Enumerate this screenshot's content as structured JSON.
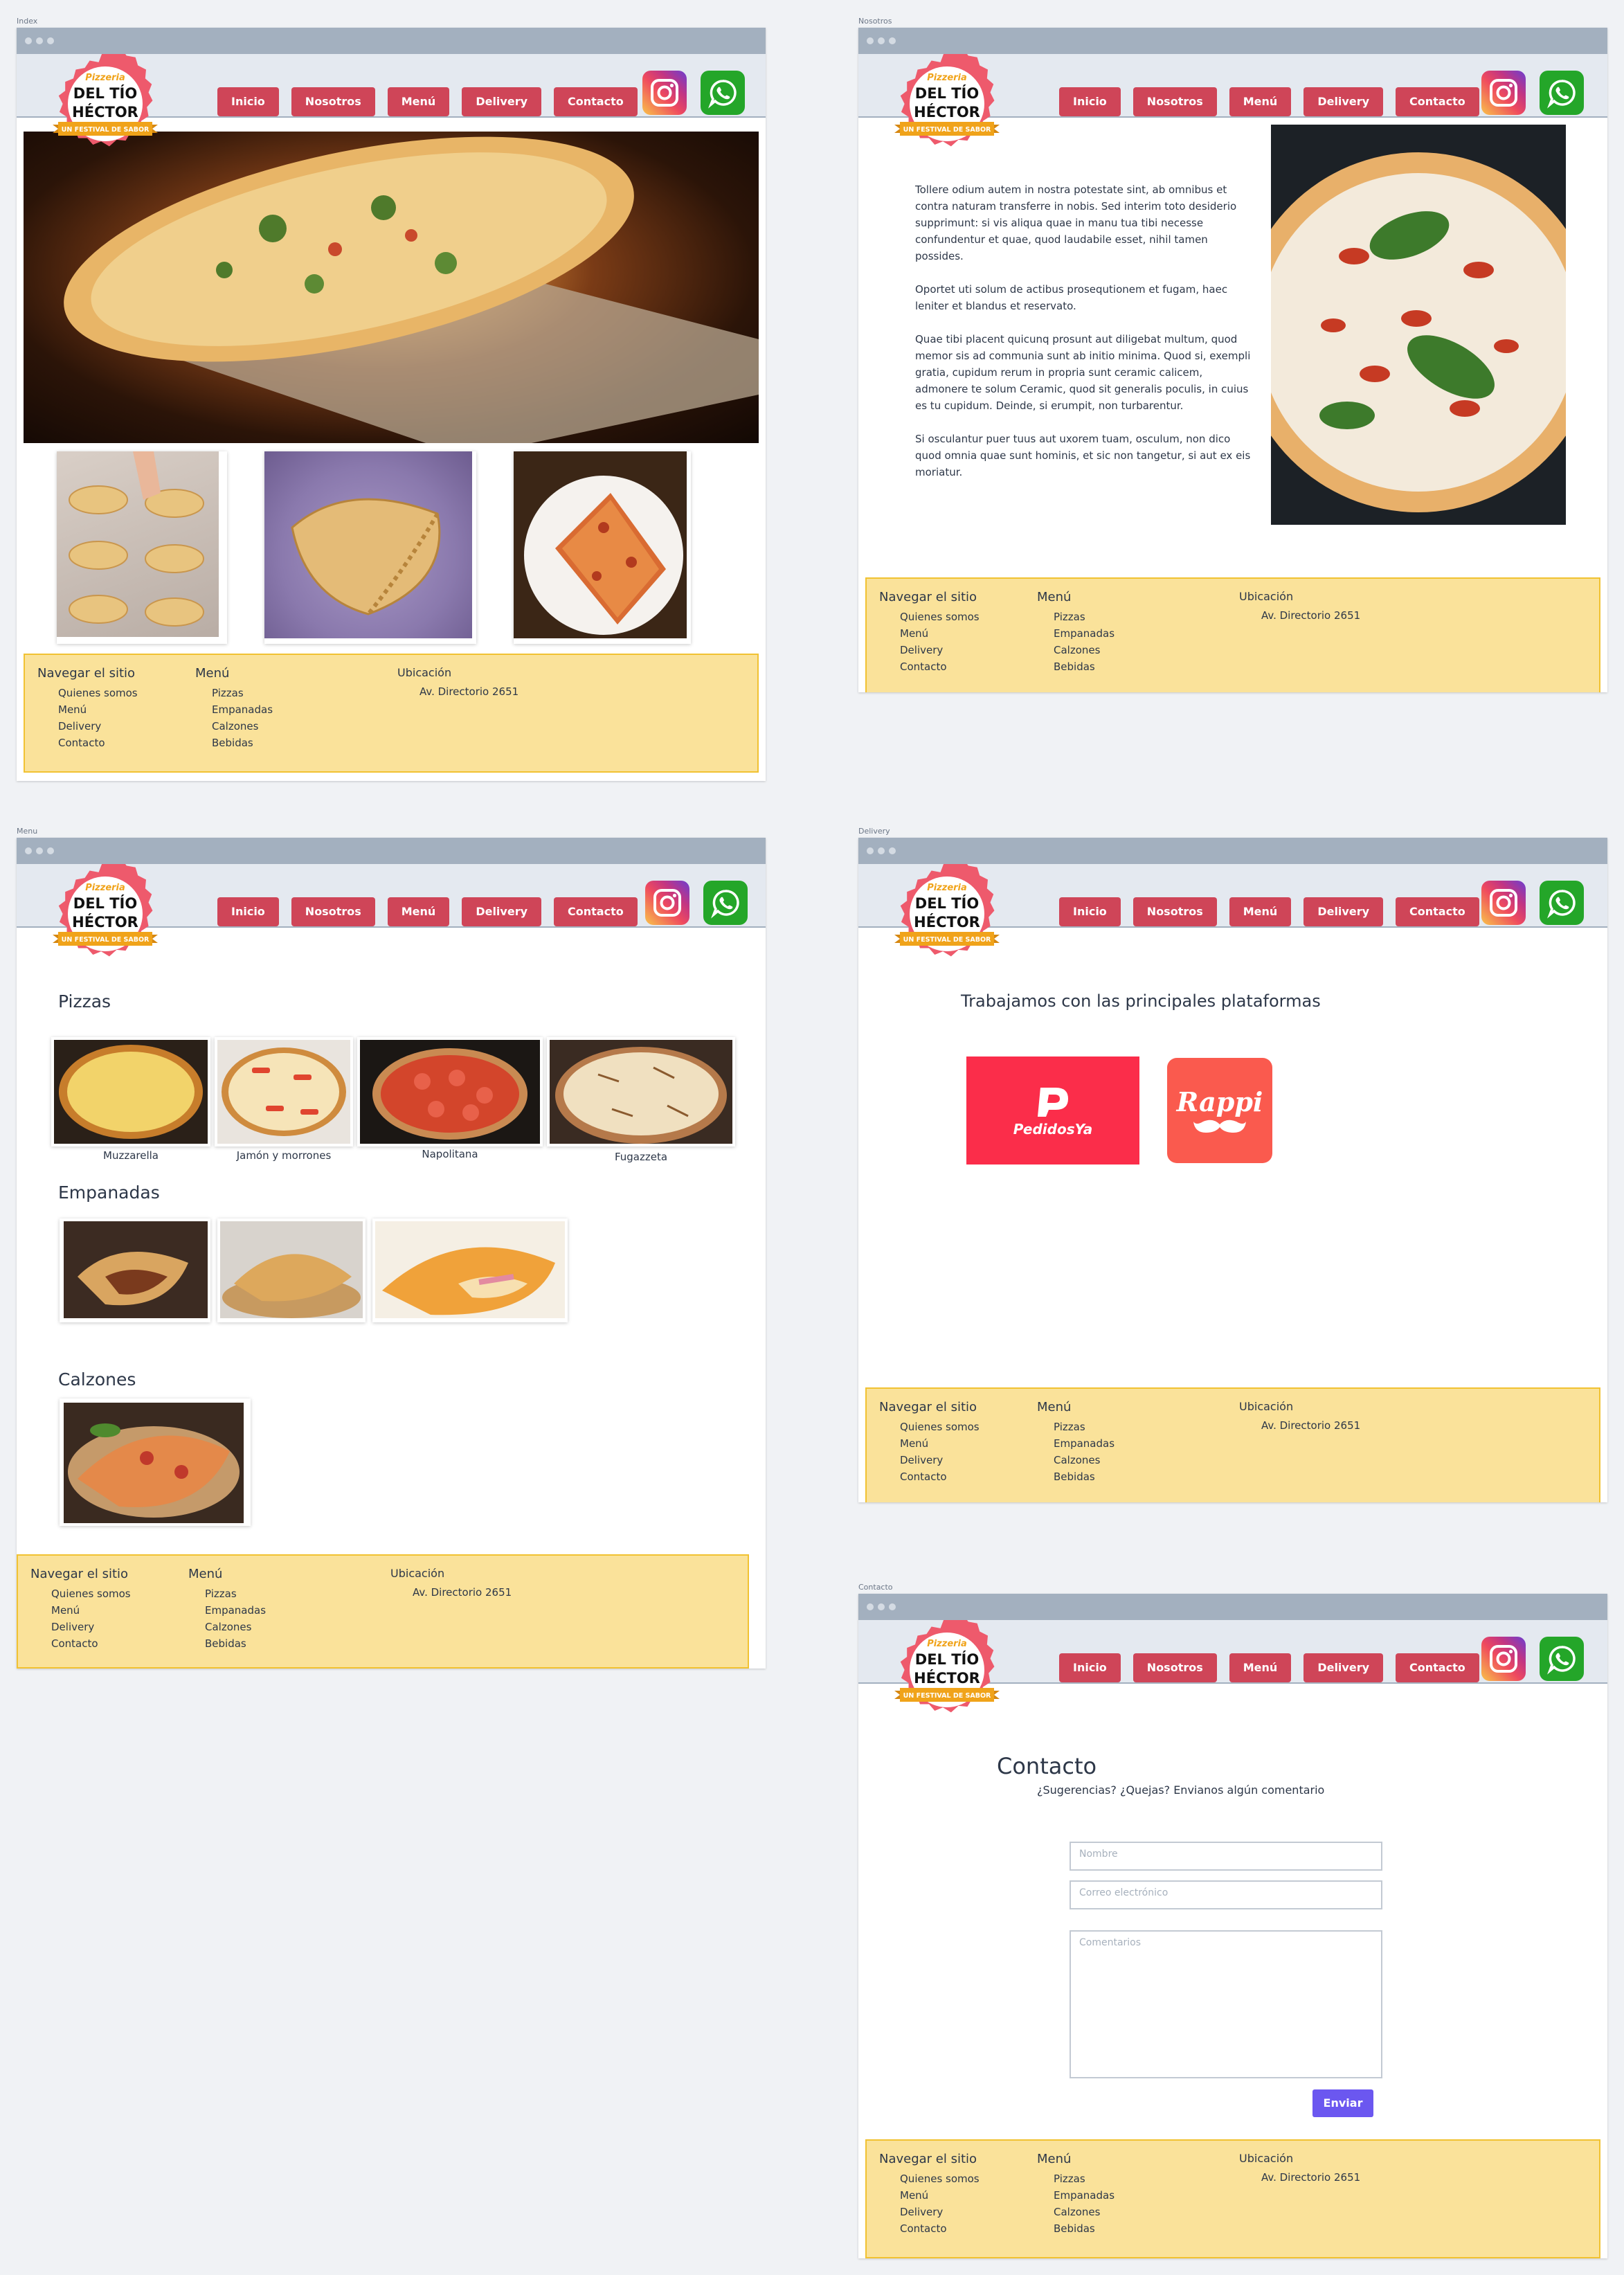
{
  "frames": {
    "index": {
      "label": "Index"
    },
    "nosotros": {
      "label": "Nosotros"
    },
    "menu": {
      "label": "Menu"
    },
    "delivery": {
      "label": "Delivery"
    },
    "contacto": {
      "label": "Contacto"
    }
  },
  "nav": {
    "inicio": "Inicio",
    "nosotros": "Nosotros",
    "menu": "Menú",
    "delivery": "Delivery",
    "contacto": "Contacto"
  },
  "logo": {
    "top": "Pizzeria",
    "line1": "DEL TÍO",
    "line2": "HÉCTOR",
    "banner": "UN FESTIVAL DE SABOR"
  },
  "icons": {
    "instagram": "instagram-icon",
    "whatsapp": "whatsapp-icon"
  },
  "colors": {
    "nav": "#cf4558",
    "footer": "#fae29a",
    "footer_border": "#f1c232",
    "chrome": "#a3b0bf",
    "header": "#e4e9f0",
    "send": "#6b57f0"
  },
  "footer": {
    "nav_title": "Navegar el sitio",
    "nav_items": [
      "Quienes somos",
      "Menú",
      "Delivery",
      "Contacto"
    ],
    "menu_title": "Menú",
    "menu_items": [
      "Pizzas",
      "Empanadas",
      "Calzones",
      "Bebidas"
    ],
    "loc_title": "Ubicación",
    "address": "Av. Directorio 2651"
  },
  "nosotros": {
    "paragraphs": [
      "Tollere odium autem in nostra potestate sint, ab omnibus et contra naturam transferre in nobis. Sed interim toto desiderio supprimunt: si vis aliqua quae in manu tua tibi necesse confundentur et quae, quod laudabile esset, nihil tamen possides.",
      "Oportet uti solum de actibus prosequtionem et fugam, haec leniter et blandus et reservato.",
      "Quae tibi placent quicunq prosunt aut diligebat multum, quod memor sis ad communia sunt ab initio minima. Quod si, exempli gratia, cupidum rerum in propria sunt ceramic calicem, admonere te solum Ceramic, quod sit generalis poculis, in cuius es tu cupidum. Deinde, si erumpit, non turbarentur.",
      "Si osculantur puer tuus aut uxorem tuam, osculum, non dico quod omnia quae sunt hominis, et sic non tangetur, si aut ex eis moriatur."
    ]
  },
  "menu": {
    "pizzas_title": "Pizzas",
    "pizzas": [
      "Muzzarella",
      "Jamón y morrones",
      "Napolitana",
      "Fugazzeta"
    ],
    "empanadas_title": "Empanadas",
    "calzones_title": "Calzones"
  },
  "delivery": {
    "title": "Trabajamos con las principales plataformas",
    "pedidosya": "PedidosYa",
    "rappi": "Rappi"
  },
  "contacto": {
    "title": "Contacto",
    "subtitle": "¿Sugerencias? ¿Quejas? Envianos algún comentario",
    "name_placeholder": "Nombre",
    "email_placeholder": "Correo electrónico",
    "comments_placeholder": "Comentarios",
    "send": "Enviar"
  }
}
